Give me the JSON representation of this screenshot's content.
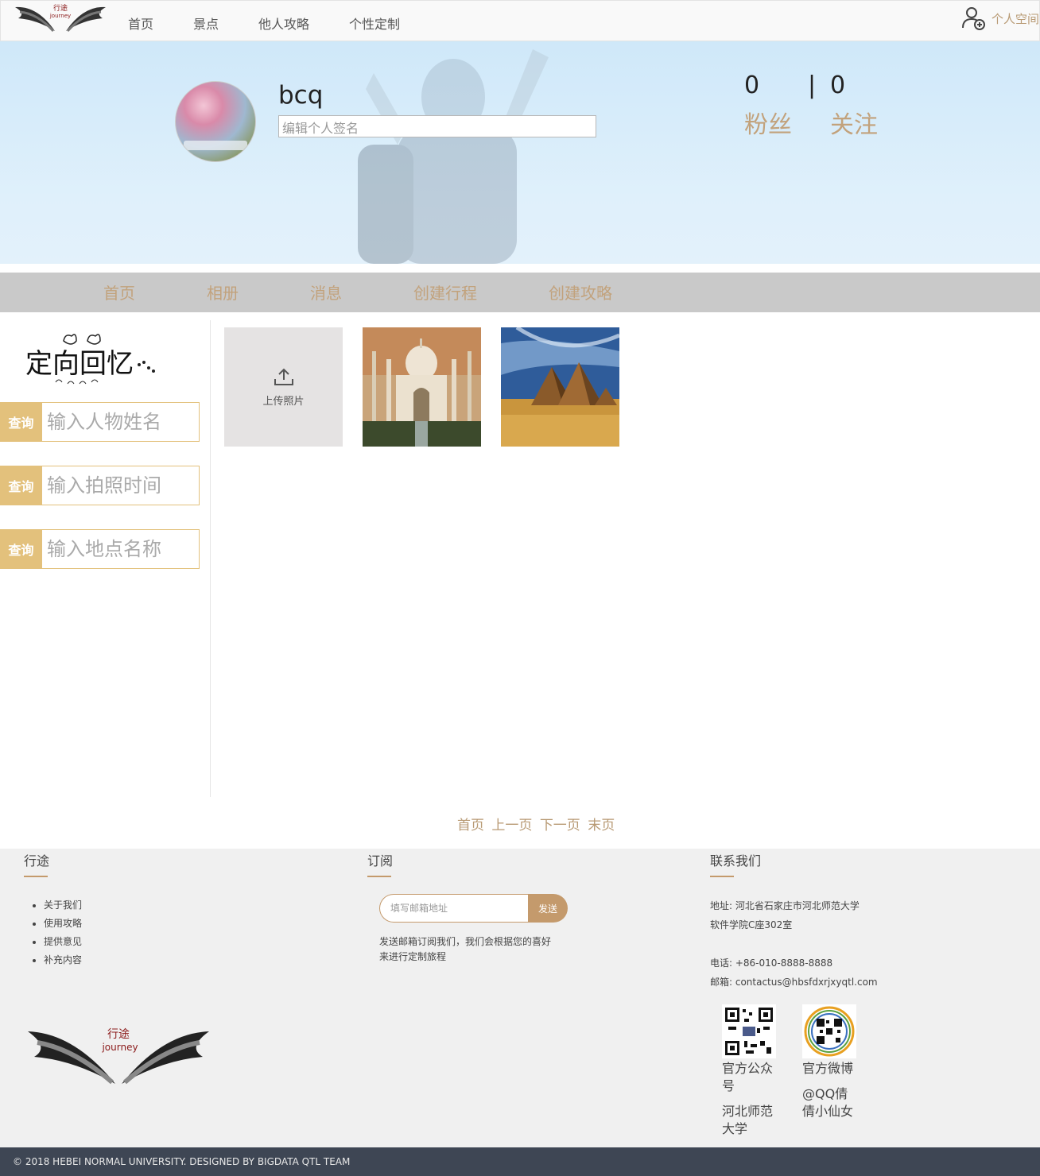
{
  "topnav": {
    "logo_text_cn": "行途",
    "logo_text_en": "journey",
    "links": [
      "首页",
      "景点",
      "他人攻略",
      "个性定制"
    ],
    "user_space": "个人空间"
  },
  "profile": {
    "username": "bcq",
    "signature_placeholder": "编辑个人签名",
    "followers_count": "0",
    "following_count": "0",
    "separator": "|",
    "followers_label": "粉丝",
    "following_label": "关注"
  },
  "subnav": {
    "items": [
      "首页",
      "相册",
      "消息",
      "创建行程",
      "创建攻略"
    ]
  },
  "sidebar": {
    "logo_text": "定向回忆",
    "queries": [
      {
        "button": "查询",
        "placeholder": "输入人物姓名"
      },
      {
        "button": "查询",
        "placeholder": "输入拍照时间"
      },
      {
        "button": "查询",
        "placeholder": "输入地点名称"
      }
    ]
  },
  "album": {
    "upload_label": "上传照片"
  },
  "pager": {
    "first": "首页",
    "prev": "上一页",
    "next": "下一页",
    "last": "末页"
  },
  "footer": {
    "col1_title": "行途",
    "links": [
      "关于我们",
      "使用攻略",
      "提供意见",
      "补充内容"
    ],
    "col2_title": "订阅",
    "email_placeholder": "填写邮箱地址",
    "send": "发送",
    "sub_desc": "发送邮箱订阅我们，我们会根据您的喜好来进行定制旅程",
    "col3_title": "联系我们",
    "address1": "地址: 河北省石家庄市河北师范大学",
    "address2": "软件学院C座302室",
    "phone": "电话: +86-010-8888-8888",
    "email": "邮箱: contactus@hbsfdxrjxyqtl.com",
    "qr1_caption1": "官方公众",
    "qr1_caption2": "号",
    "qr1_caption3": "河北师范",
    "qr1_caption4": "大学",
    "qr2_caption1": "官方微博",
    "qr2_caption2": "@QQ倩",
    "qr2_caption3": "倩小仙女",
    "logo_text_cn": "行途",
    "logo_text_en": "journey"
  },
  "copyright": "© 2018 HEBEI NORMAL UNIVERSITY. DESIGNED BY BIGDATA QTL TEAM",
  "colors": {
    "accent": "#c2a27c",
    "query_gold": "#e3c17c",
    "bottom_bar": "#3e4654"
  }
}
